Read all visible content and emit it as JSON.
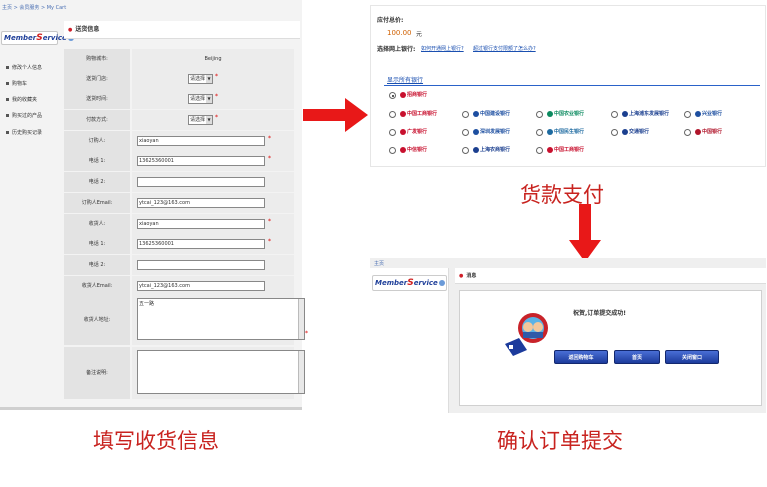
{
  "left": {
    "breadcrumb": "主页 > 会员服务 > My Cart",
    "logo_left": "Member",
    "logo_s": "S",
    "logo_right": "ervice",
    "sidebar": [
      "修改个人信息",
      "购物车",
      "我的收藏夹",
      "购买过的产品",
      "历史购买记录"
    ],
    "section_title": "送货信息",
    "rows": [
      {
        "label": "购物城市:",
        "value": "Beijing",
        "kind": "text"
      },
      {
        "label": "送货门店:",
        "value": "请选择",
        "kind": "select"
      },
      {
        "label": "送货时间:",
        "value": "请选择",
        "kind": "select"
      },
      {
        "label": "付款方式:",
        "value": "请选择",
        "kind": "select"
      },
      {
        "label": "订购人:",
        "value": "xiaoyan",
        "kind": "input",
        "req": true
      },
      {
        "label": "电话 1:",
        "value": "13625360001",
        "kind": "input",
        "req": true
      },
      {
        "label": "电话 2:",
        "value": "",
        "kind": "input"
      },
      {
        "label": "订购人Email:",
        "value": "ytcai_123@163.com",
        "kind": "input"
      },
      {
        "label": "收货人:",
        "value": "xiaoyan",
        "kind": "input",
        "req": true
      },
      {
        "label": "电话 1:",
        "value": "13625360001",
        "kind": "input",
        "req": true
      },
      {
        "label": "电话 2:",
        "value": "",
        "kind": "input"
      },
      {
        "label": "收货人Email:",
        "value": "ytcai_123@163.com",
        "kind": "input"
      }
    ],
    "address_label": "收货人地址:",
    "address_value": "五一路",
    "note_label": "备注说明:",
    "required_mark": "*"
  },
  "payment": {
    "total_label": "应付总价:",
    "amount": "100.00",
    "unit": "元",
    "bank_q_label": "选择网上银行:",
    "link1": "如何开通网上银行?",
    "link2": "超过银行支付限额了怎么办?",
    "show_all": "显示所有银行",
    "banks": [
      {
        "name": "招商银行",
        "color": "#c8102e",
        "checked": true
      },
      {
        "name": "中国工商银行",
        "color": "#c8102e"
      },
      {
        "name": "中国建设银行",
        "color": "#1c4ea1"
      },
      {
        "name": "中国农业银行",
        "color": "#0b8a5f"
      },
      {
        "name": "上海浦东发展银行",
        "color": "#1b3f8f"
      },
      {
        "name": "兴业银行",
        "color": "#1d4fa0"
      },
      {
        "name": "广发银行",
        "color": "#c8102e"
      },
      {
        "name": "深圳发展银行",
        "color": "#1d4fa0"
      },
      {
        "name": "中国民生银行",
        "color": "#1d6aa0"
      },
      {
        "name": "交通银行",
        "color": "#1b3f8f"
      },
      {
        "name": "中国银行",
        "color": "#b0142a"
      },
      {
        "name": "中信银行",
        "color": "#c8102e"
      },
      {
        "name": "上海农商银行",
        "color": "#1b3f8f"
      },
      {
        "name": "中国工商银行",
        "color": "#c8102e"
      }
    ]
  },
  "captions": {
    "pay": "货款支付",
    "fill": "填写收货信息",
    "confirm": "确认订单提交"
  },
  "success": {
    "breadcrumb": "主页",
    "logo_left": "Member",
    "logo_s": "S",
    "logo_right": "ervice",
    "head": "消息",
    "message": "祝贺,订单提交成功!",
    "buttons": [
      "返回购物车",
      "首页",
      "关闭窗口"
    ]
  }
}
